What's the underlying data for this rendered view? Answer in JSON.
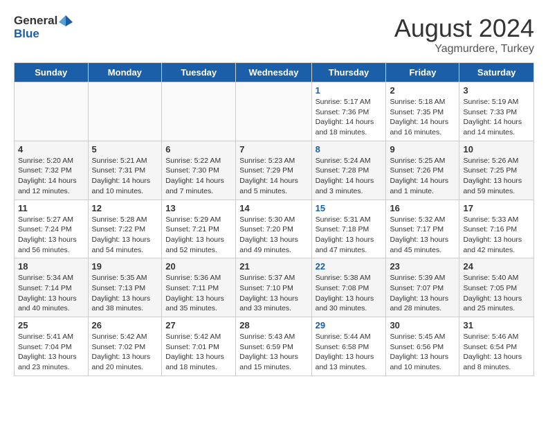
{
  "header": {
    "logo_general": "General",
    "logo_blue": "Blue",
    "month_year": "August 2024",
    "location": "Yagmurdere, Turkey"
  },
  "weekdays": [
    "Sunday",
    "Monday",
    "Tuesday",
    "Wednesday",
    "Thursday",
    "Friday",
    "Saturday"
  ],
  "weeks": [
    [
      {
        "day": "",
        "content": ""
      },
      {
        "day": "",
        "content": ""
      },
      {
        "day": "",
        "content": ""
      },
      {
        "day": "",
        "content": ""
      },
      {
        "day": "1",
        "is_thursday": true,
        "content": "Sunrise: 5:17 AM\nSunset: 7:36 PM\nDaylight: 14 hours\nand 18 minutes."
      },
      {
        "day": "2",
        "content": "Sunrise: 5:18 AM\nSunset: 7:35 PM\nDaylight: 14 hours\nand 16 minutes."
      },
      {
        "day": "3",
        "content": "Sunrise: 5:19 AM\nSunset: 7:33 PM\nDaylight: 14 hours\nand 14 minutes."
      }
    ],
    [
      {
        "day": "4",
        "content": "Sunrise: 5:20 AM\nSunset: 7:32 PM\nDaylight: 14 hours\nand 12 minutes."
      },
      {
        "day": "5",
        "content": "Sunrise: 5:21 AM\nSunset: 7:31 PM\nDaylight: 14 hours\nand 10 minutes."
      },
      {
        "day": "6",
        "content": "Sunrise: 5:22 AM\nSunset: 7:30 PM\nDaylight: 14 hours\nand 7 minutes."
      },
      {
        "day": "7",
        "content": "Sunrise: 5:23 AM\nSunset: 7:29 PM\nDaylight: 14 hours\nand 5 minutes."
      },
      {
        "day": "8",
        "is_thursday": true,
        "content": "Sunrise: 5:24 AM\nSunset: 7:28 PM\nDaylight: 14 hours\nand 3 minutes."
      },
      {
        "day": "9",
        "content": "Sunrise: 5:25 AM\nSunset: 7:26 PM\nDaylight: 14 hours\nand 1 minute."
      },
      {
        "day": "10",
        "content": "Sunrise: 5:26 AM\nSunset: 7:25 PM\nDaylight: 13 hours\nand 59 minutes."
      }
    ],
    [
      {
        "day": "11",
        "content": "Sunrise: 5:27 AM\nSunset: 7:24 PM\nDaylight: 13 hours\nand 56 minutes."
      },
      {
        "day": "12",
        "content": "Sunrise: 5:28 AM\nSunset: 7:22 PM\nDaylight: 13 hours\nand 54 minutes."
      },
      {
        "day": "13",
        "content": "Sunrise: 5:29 AM\nSunset: 7:21 PM\nDaylight: 13 hours\nand 52 minutes."
      },
      {
        "day": "14",
        "content": "Sunrise: 5:30 AM\nSunset: 7:20 PM\nDaylight: 13 hours\nand 49 minutes."
      },
      {
        "day": "15",
        "is_thursday": true,
        "content": "Sunrise: 5:31 AM\nSunset: 7:18 PM\nDaylight: 13 hours\nand 47 minutes."
      },
      {
        "day": "16",
        "content": "Sunrise: 5:32 AM\nSunset: 7:17 PM\nDaylight: 13 hours\nand 45 minutes."
      },
      {
        "day": "17",
        "content": "Sunrise: 5:33 AM\nSunset: 7:16 PM\nDaylight: 13 hours\nand 42 minutes."
      }
    ],
    [
      {
        "day": "18",
        "content": "Sunrise: 5:34 AM\nSunset: 7:14 PM\nDaylight: 13 hours\nand 40 minutes."
      },
      {
        "day": "19",
        "content": "Sunrise: 5:35 AM\nSunset: 7:13 PM\nDaylight: 13 hours\nand 38 minutes."
      },
      {
        "day": "20",
        "content": "Sunrise: 5:36 AM\nSunset: 7:11 PM\nDaylight: 13 hours\nand 35 minutes."
      },
      {
        "day": "21",
        "content": "Sunrise: 5:37 AM\nSunset: 7:10 PM\nDaylight: 13 hours\nand 33 minutes."
      },
      {
        "day": "22",
        "is_thursday": true,
        "content": "Sunrise: 5:38 AM\nSunset: 7:08 PM\nDaylight: 13 hours\nand 30 minutes."
      },
      {
        "day": "23",
        "content": "Sunrise: 5:39 AM\nSunset: 7:07 PM\nDaylight: 13 hours\nand 28 minutes."
      },
      {
        "day": "24",
        "content": "Sunrise: 5:40 AM\nSunset: 7:05 PM\nDaylight: 13 hours\nand 25 minutes."
      }
    ],
    [
      {
        "day": "25",
        "content": "Sunrise: 5:41 AM\nSunset: 7:04 PM\nDaylight: 13 hours\nand 23 minutes."
      },
      {
        "day": "26",
        "content": "Sunrise: 5:42 AM\nSunset: 7:02 PM\nDaylight: 13 hours\nand 20 minutes."
      },
      {
        "day": "27",
        "content": "Sunrise: 5:42 AM\nSunset: 7:01 PM\nDaylight: 13 hours\nand 18 minutes."
      },
      {
        "day": "28",
        "content": "Sunrise: 5:43 AM\nSunset: 6:59 PM\nDaylight: 13 hours\nand 15 minutes."
      },
      {
        "day": "29",
        "is_thursday": true,
        "content": "Sunrise: 5:44 AM\nSunset: 6:58 PM\nDaylight: 13 hours\nand 13 minutes."
      },
      {
        "day": "30",
        "content": "Sunrise: 5:45 AM\nSunset: 6:56 PM\nDaylight: 13 hours\nand 10 minutes."
      },
      {
        "day": "31",
        "content": "Sunrise: 5:46 AM\nSunset: 6:54 PM\nDaylight: 13 hours\nand 8 minutes."
      }
    ]
  ]
}
